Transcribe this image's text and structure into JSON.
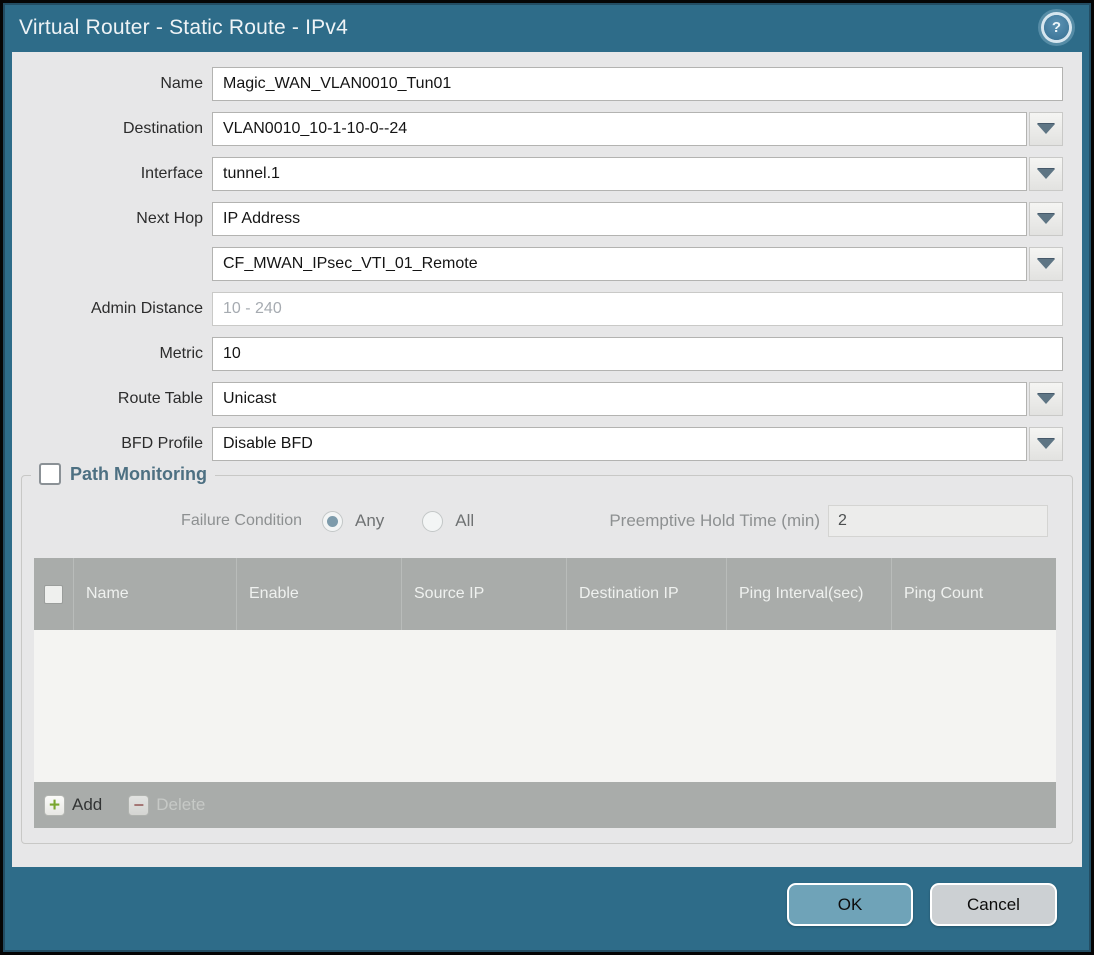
{
  "dialog": {
    "title": "Virtual Router - Static Route - IPv4"
  },
  "icons": {
    "help": "?",
    "add": "+",
    "delete": "−",
    "dropdown": "triangle-down"
  },
  "form": {
    "name": {
      "label": "Name",
      "value": "Magic_WAN_VLAN0010_Tun01"
    },
    "destination": {
      "label": "Destination",
      "value": "VLAN0010_10-1-10-0--24"
    },
    "interface": {
      "label": "Interface",
      "value": "tunnel.1"
    },
    "next_hop": {
      "label": "Next Hop",
      "value": "IP Address"
    },
    "next_hop_address": {
      "label": "",
      "value": "CF_MWAN_IPsec_VTI_01_Remote"
    },
    "admin_distance": {
      "label": "Admin Distance",
      "placeholder": "10 - 240",
      "value": ""
    },
    "metric": {
      "label": "Metric",
      "value": "10"
    },
    "route_table": {
      "label": "Route Table",
      "value": "Unicast"
    },
    "bfd_profile": {
      "label": "BFD Profile",
      "value": "Disable BFD"
    }
  },
  "path_monitoring": {
    "legend": "Path Monitoring",
    "enabled": false,
    "failure_condition": {
      "label": "Failure Condition",
      "options": [
        "Any",
        "All"
      ],
      "selected": "Any"
    },
    "preemptive_hold_time": {
      "label": "Preemptive Hold Time (min)",
      "value": "2"
    },
    "table": {
      "headers": [
        "Name",
        "Enable",
        "Source IP",
        "Destination IP",
        "Ping Interval(sec)",
        "Ping Count"
      ],
      "rows": []
    },
    "add_button": "Add",
    "delete_button": "Delete"
  },
  "actions": {
    "ok": "OK",
    "cancel": "Cancel"
  },
  "colors": {
    "titlebar": "#2e6c89",
    "panel_bg": "#e7e7e8",
    "table_header_bg": "#a9acaa",
    "table_body_bg": "#f4f4f2",
    "ok_button_bg": "#6fa3b8",
    "cancel_button_bg": "#ccd0d3",
    "legend_text": "#4d7082",
    "add_icon_green": "#79a62f",
    "delete_icon_red": "#a2605e",
    "radio_selected_fill": "#7d9bab"
  }
}
